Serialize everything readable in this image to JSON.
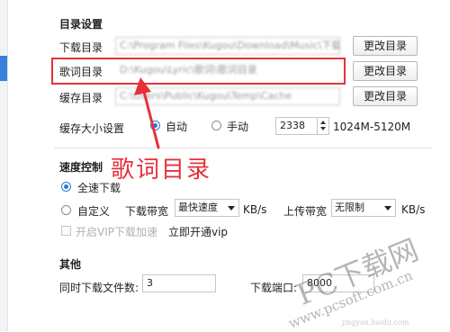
{
  "dir_section": {
    "title": "目录设置",
    "download_dir": {
      "label": "下载目录",
      "value": "C:\\Program Files\\Kugou\\Download\\Music\\下载",
      "button": "更改目录"
    },
    "lyrics_dir": {
      "label": "歌词目录",
      "value": "D:\\Kugou\\Lyric\\歌词\\歌词目录",
      "button": "更改目录"
    },
    "cache_dir": {
      "label": "缓存目录",
      "value": "C:\\Users\\Public\\Kugou\\Temp\\Cache",
      "button": "更改目录"
    },
    "cache_size": {
      "label": "缓存大小设置",
      "auto_label": "自动",
      "manual_label": "手动",
      "value": "2338",
      "range_text": "1024M-5120M",
      "selected": "auto"
    }
  },
  "speed_section": {
    "title": "速度控制",
    "full_speed_label": "全速下载",
    "custom_label": "自定义",
    "selected": "full_speed",
    "download_bw_label": "下载带宽",
    "download_bw_value": "最快速度",
    "download_bw_unit": "KB/s",
    "upload_bw_label": "上传带宽",
    "upload_bw_value": "无限制",
    "upload_bw_unit": "KB/s",
    "vip_checkbox_label": "开启VIP下载加速",
    "vip_link": "立即开通vip"
  },
  "other_section": {
    "title": "其他",
    "concurrent_label": "同时下载文件数:",
    "concurrent_value": "3",
    "port_label": "下载端口:",
    "port_value": "8000"
  },
  "annotation": {
    "text": "歌词目录",
    "color": "#e8303a"
  },
  "watermark": {
    "main": "PC下载网",
    "url": "www.pcsoft.com.cn",
    "sub": "jingyan.baidu.com"
  }
}
